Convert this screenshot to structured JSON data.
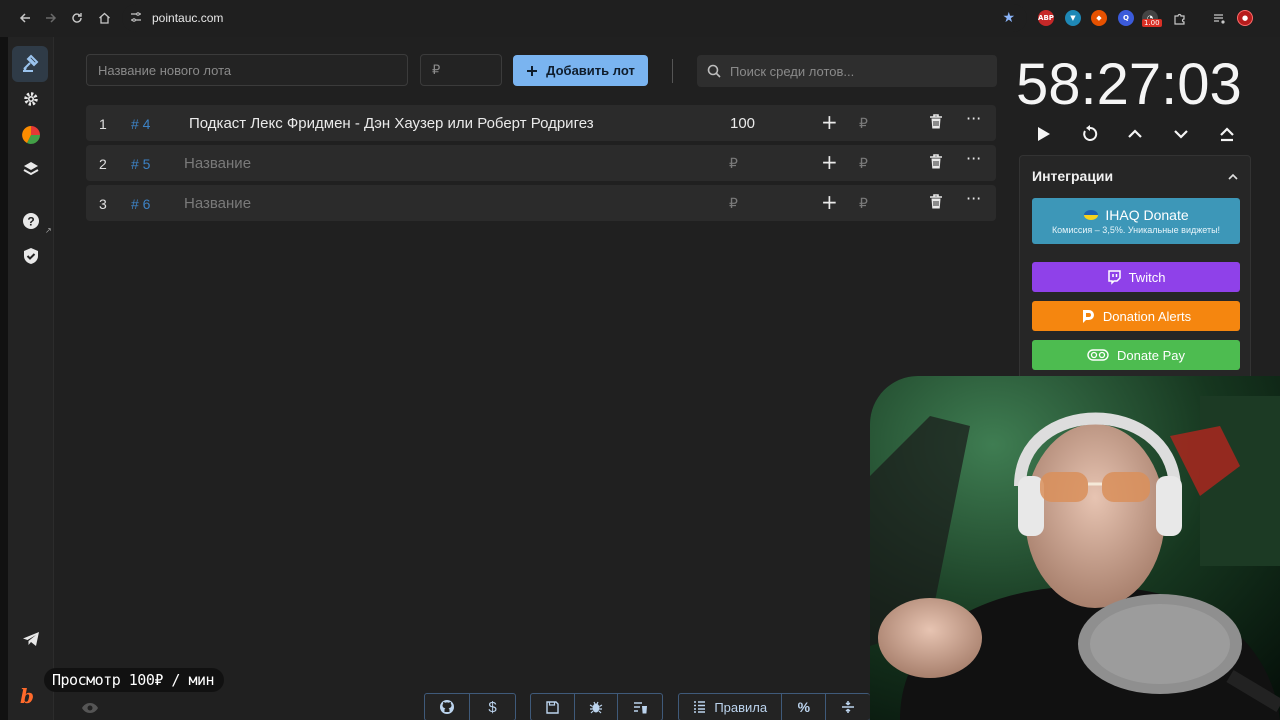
{
  "browser": {
    "url": "pointauc.com",
    "ext_badge": "1.00",
    "ext_abp": "ABP"
  },
  "lot_form": {
    "name_placeholder": "Название нового лота",
    "amount_placeholder": "₽",
    "add_button": "Добавить лот",
    "search_placeholder": "Поиск среди лотов..."
  },
  "lots": [
    {
      "index": "1",
      "tag": "# 4",
      "name": "Подкаст Лекс Фридмен - Дэн Хаузер или Роберт Родригез",
      "amount": "100",
      "currency": "₽"
    },
    {
      "index": "2",
      "tag": "# 5",
      "name": "Название",
      "amount": "₽",
      "currency": "₽"
    },
    {
      "index": "3",
      "tag": "# 6",
      "name": "Название",
      "amount": "₽",
      "currency": "₽"
    }
  ],
  "timer": {
    "value": "58:27:03"
  },
  "integrations": {
    "title": "Интеграции",
    "services": {
      "ihaq": {
        "label": "IHAQ Donate",
        "sub": "Комиссия – 3,5%. Уникальные виджеты!",
        "color": "#3d97b8"
      },
      "twitch": {
        "label": "Twitch",
        "color": "#8f41e9"
      },
      "donation_alerts": {
        "label": "Donation Alerts",
        "color": "#f5860f"
      },
      "donate_pay": {
        "label": "Donate Pay",
        "color": "#4dbc50"
      }
    }
  },
  "toolbar": {
    "rules_label": "Правила"
  },
  "overlay": {
    "view_banner": "Просмотр 100₽ / мин"
  },
  "colors": {
    "accent": "#7ab4f0",
    "tag_blue": "#3d82c4",
    "background": "#202020"
  }
}
